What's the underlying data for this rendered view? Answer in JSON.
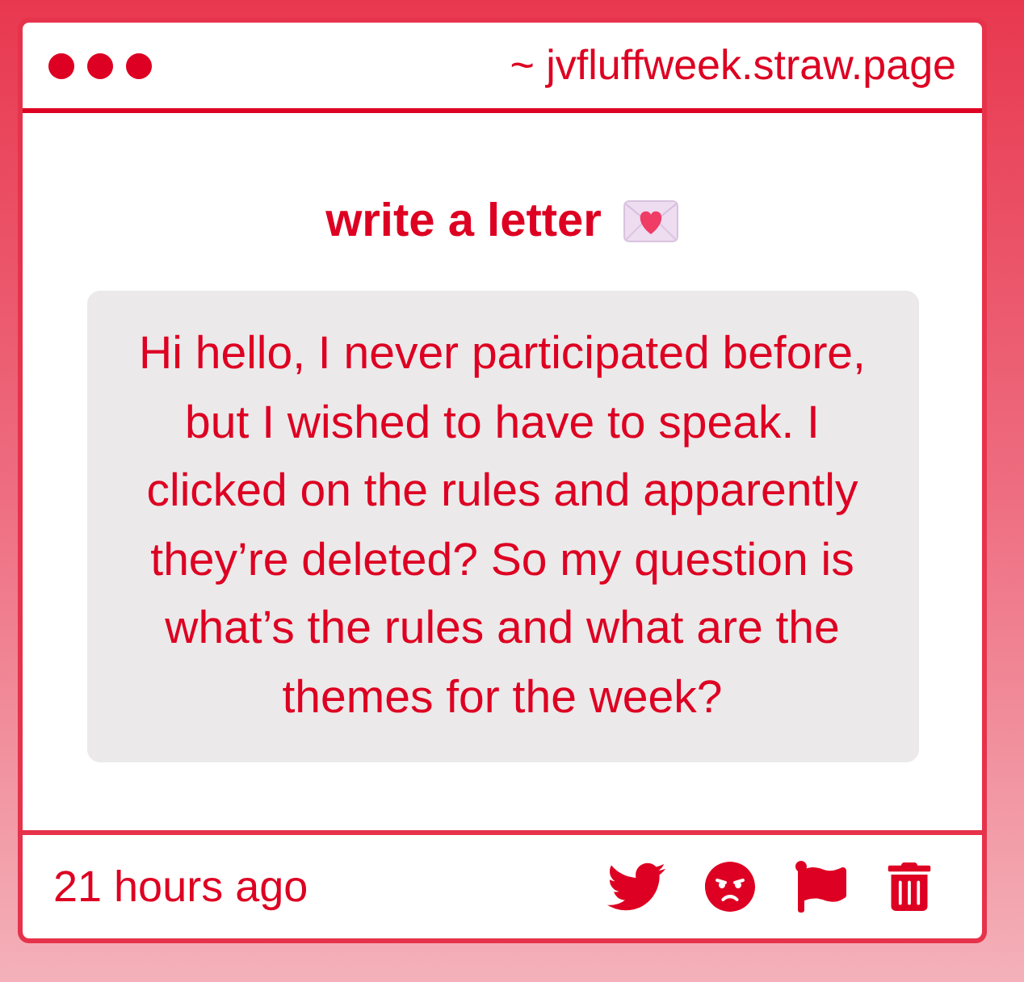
{
  "window": {
    "url": "~ jvfluffweek.straw.page"
  },
  "post": {
    "title": "write a letter",
    "message": "Hi hello, I never participated before, but I wished to have to speak. I clicked on the rules and apparently they’re deleted? So my question is what’s the rules and what are the themes for the week?"
  },
  "footer": {
    "time": "21 hours ago"
  }
}
